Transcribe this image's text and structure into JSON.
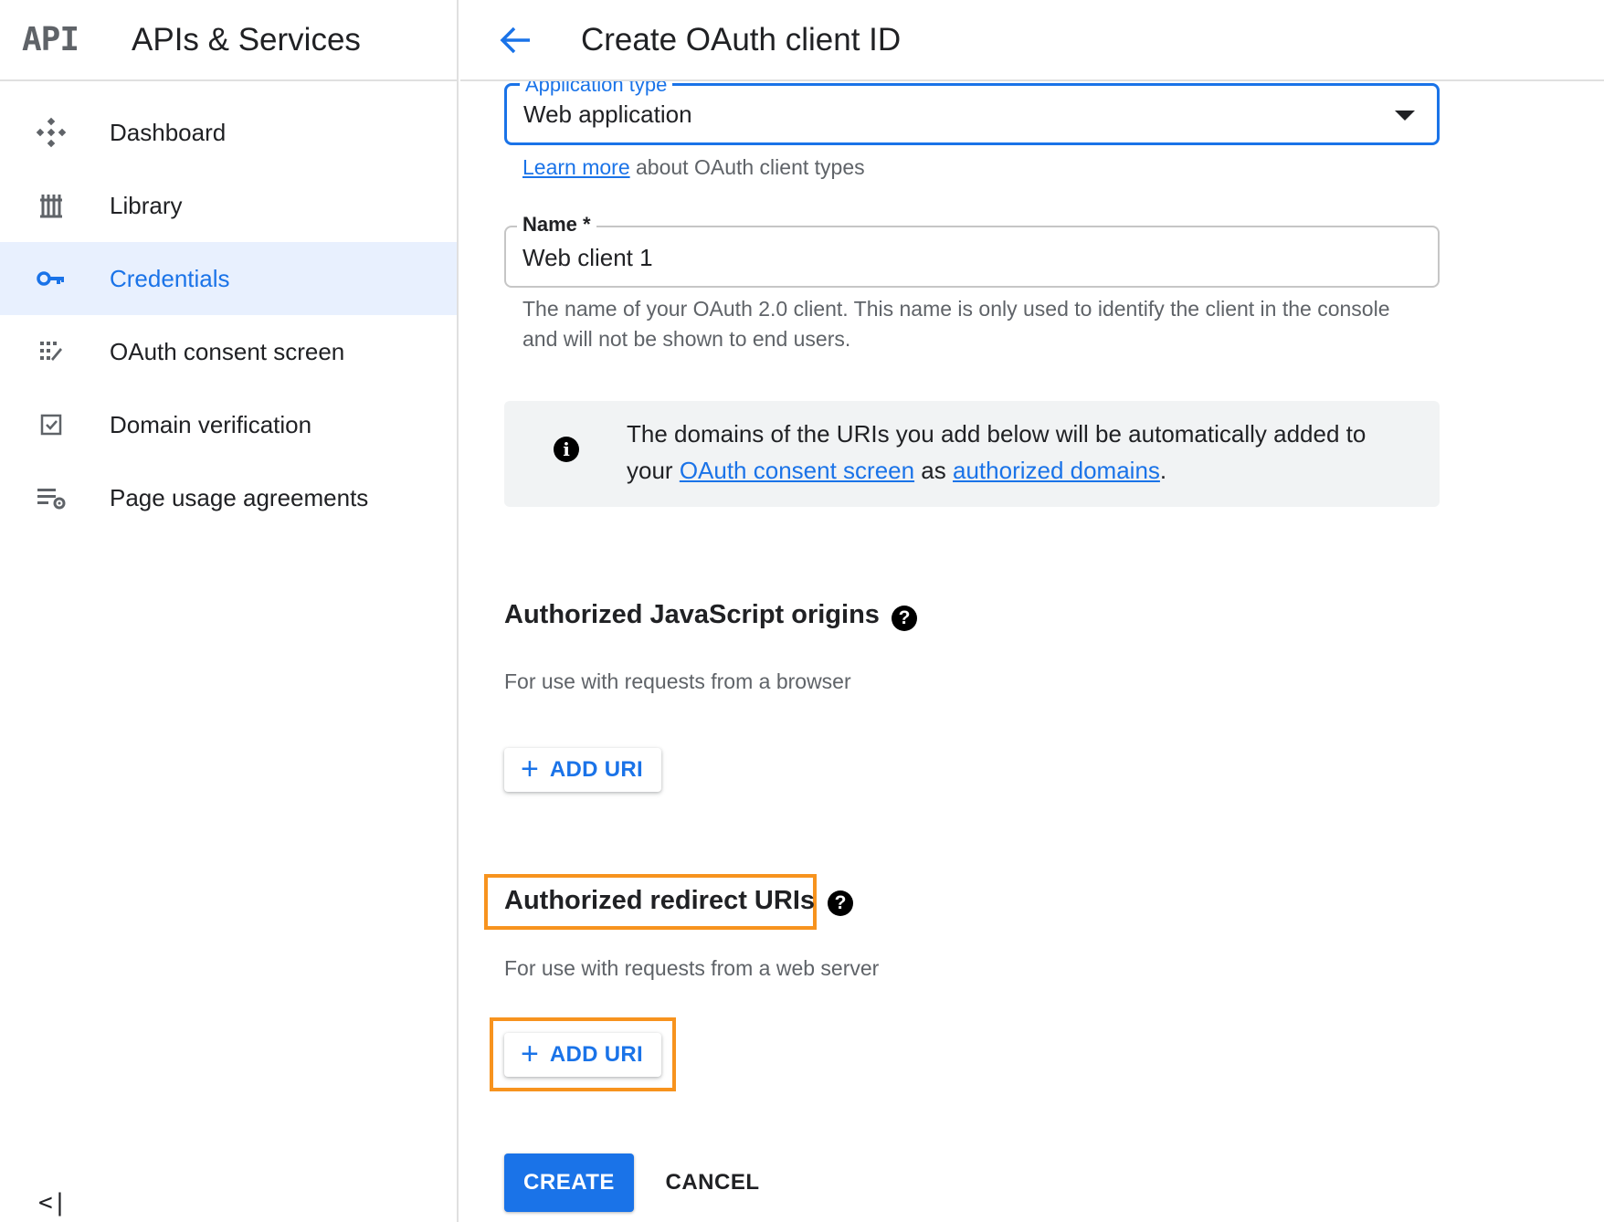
{
  "sidebar": {
    "logo": "API",
    "title": "APIs & Services",
    "items": [
      {
        "label": "Dashboard",
        "icon": "dashboard-icon"
      },
      {
        "label": "Library",
        "icon": "library-icon"
      },
      {
        "label": "Credentials",
        "icon": "key-icon",
        "active": true
      },
      {
        "label": "OAuth consent screen",
        "icon": "consent-screen-icon"
      },
      {
        "label": "Domain verification",
        "icon": "checkbox-icon"
      },
      {
        "label": "Page usage agreements",
        "icon": "settings-list-icon"
      }
    ],
    "collapse": "<|"
  },
  "header": {
    "title": "Create OAuth client ID"
  },
  "form": {
    "application_type": {
      "label": "Application type",
      "value": "Web application"
    },
    "learn_more": {
      "link": "Learn more",
      "text": " about OAuth client types"
    },
    "name": {
      "label": "Name *",
      "value": "Web client 1",
      "helper": "The name of your OAuth 2.0 client. This name is only used to identify the client in the console and will not be shown to end users."
    },
    "info": {
      "text_1": "The domains of the URIs you add below will be automatically added to your ",
      "link_1": "OAuth consent screen",
      "text_2": " as ",
      "link_2": "authorized domains",
      "text_3": "."
    },
    "js_origins": {
      "title": "Authorized JavaScript origins",
      "subtitle": "For use with requests from a browser",
      "button": "ADD URI"
    },
    "redirect_uris": {
      "title": "Authorized redirect URIs",
      "subtitle": "For use with requests from a web server",
      "button": "ADD URI"
    },
    "create": "CREATE",
    "cancel": "CANCEL"
  },
  "colors": {
    "accent": "#1a73e8",
    "highlight": "#f7931e",
    "active_bg": "#e8f0fe"
  }
}
